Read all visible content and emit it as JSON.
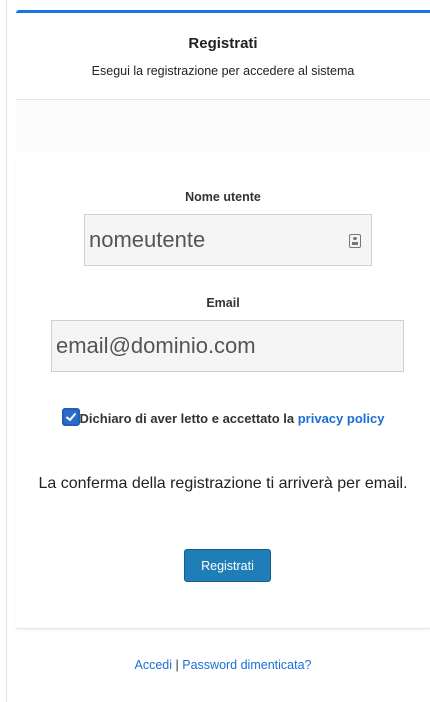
{
  "header": {
    "title": "Registrati",
    "subtitle": "Esegui la registrazione per accedere al sistema"
  },
  "form": {
    "username": {
      "label": "Nome utente",
      "placeholder": "nomeutente",
      "value": ""
    },
    "email": {
      "label": "Email",
      "placeholder": "email@dominio.com",
      "value": ""
    },
    "privacy": {
      "checked": true,
      "text": "Dichiaro di aver letto e accettato la ",
      "link_label": "privacy policy"
    },
    "confirm_text": "La conferma della registrazione ti arriverà per email.",
    "submit_label": "Registrati"
  },
  "footer": {
    "login_link": "Accedi",
    "separator": "|",
    "forgot_link": "Password dimenticata?"
  },
  "colors": {
    "accent": "#1a74e6",
    "link": "#1a6fd6",
    "button": "#1f7eb8"
  },
  "icons": {
    "username_field_icon": "id-card-icon",
    "checkbox_icon": "checkmark-icon"
  }
}
